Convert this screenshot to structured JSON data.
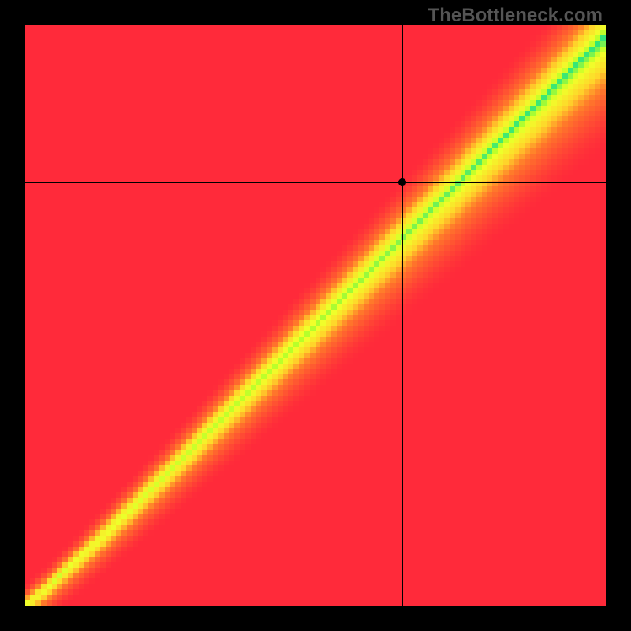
{
  "attribution": "TheBottleneck.com",
  "chart_data": {
    "type": "heatmap",
    "title": "",
    "xlabel": "",
    "ylabel": "",
    "xlim": [
      0,
      100
    ],
    "ylim": [
      0,
      100
    ],
    "crosshair": {
      "x": 65,
      "y": 73
    },
    "grid_size": 108,
    "ideal_ratio_description": "diagonal optimal band (green) with red at top-left and bottom-right, yellow/orange transition",
    "color_stops": [
      {
        "value": 0.0,
        "color": "#ff2a3a"
      },
      {
        "value": 0.35,
        "color": "#ff7a2a"
      },
      {
        "value": 0.55,
        "color": "#ffd52a"
      },
      {
        "value": 0.78,
        "color": "#f0ff2a"
      },
      {
        "value": 0.88,
        "color": "#b7ff2a"
      },
      {
        "value": 1.0,
        "color": "#18e08a"
      }
    ]
  }
}
